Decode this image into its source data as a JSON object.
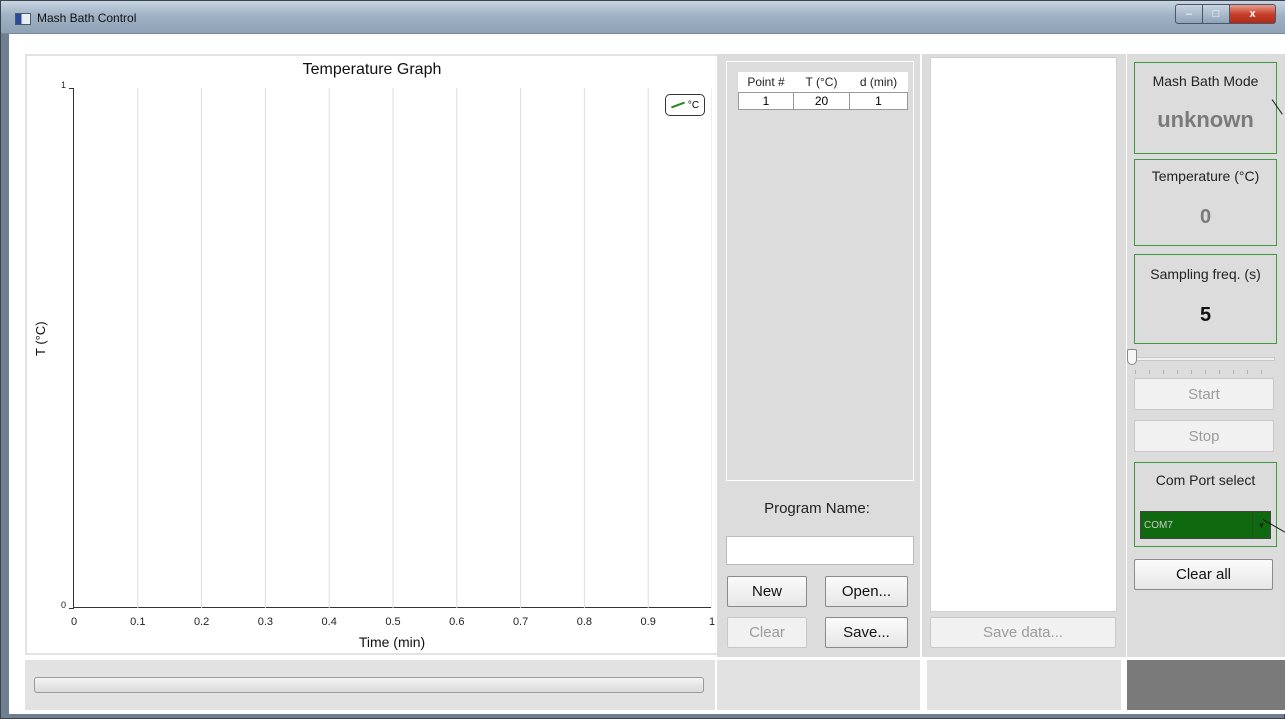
{
  "window": {
    "title": "Mash Bath Control",
    "controls": {
      "minimize": "–",
      "maximize": "□",
      "close": "x"
    }
  },
  "graph": {
    "title": "Temperature Graph",
    "legend_label": "°C",
    "line_color": "#1f8a1f"
  },
  "chart_data": {
    "type": "line",
    "title": "Temperature Graph",
    "xlabel": "Time (min)",
    "ylabel": "T (°C)",
    "xlim": [
      0,
      1
    ],
    "ylim": [
      0,
      1
    ],
    "x_ticks": [
      "0",
      "0.1",
      "0.2",
      "0.3",
      "0.4",
      "0.5",
      "0.6",
      "0.7",
      "0.8",
      "0.9",
      "1"
    ],
    "y_ticks": [
      "0",
      "1"
    ],
    "grid": "vertical",
    "legend_position": "top-right",
    "series": [
      {
        "name": "°C",
        "x": [],
        "y": []
      }
    ]
  },
  "program": {
    "table": {
      "headers": [
        "Point #",
        "T (°C)",
        "d (min)"
      ],
      "rows": [
        [
          "1",
          "20",
          "1"
        ]
      ]
    },
    "name_label": "Program Name:",
    "name_value": "",
    "buttons": {
      "new": "New",
      "open": "Open...",
      "clear": "Clear",
      "save": "Save..."
    }
  },
  "data_panel": {
    "save_data": "Save data..."
  },
  "status": {
    "mode_title": "Mash Bath Mode",
    "mode_value": "unknown",
    "temp_title": "Temperature (°C)",
    "temp_value": "0",
    "freq_title": "Sampling freq. (s)",
    "freq_value": "5",
    "start": "Start",
    "stop": "Stop",
    "com_title": "Com Port select",
    "com_value": "COM7",
    "clear_all": "Clear all"
  },
  "colors": {
    "accent_green": "#3d9a3d",
    "com_select_bg": "#0f6a0f",
    "panel_grey": "#dcdcdc"
  }
}
